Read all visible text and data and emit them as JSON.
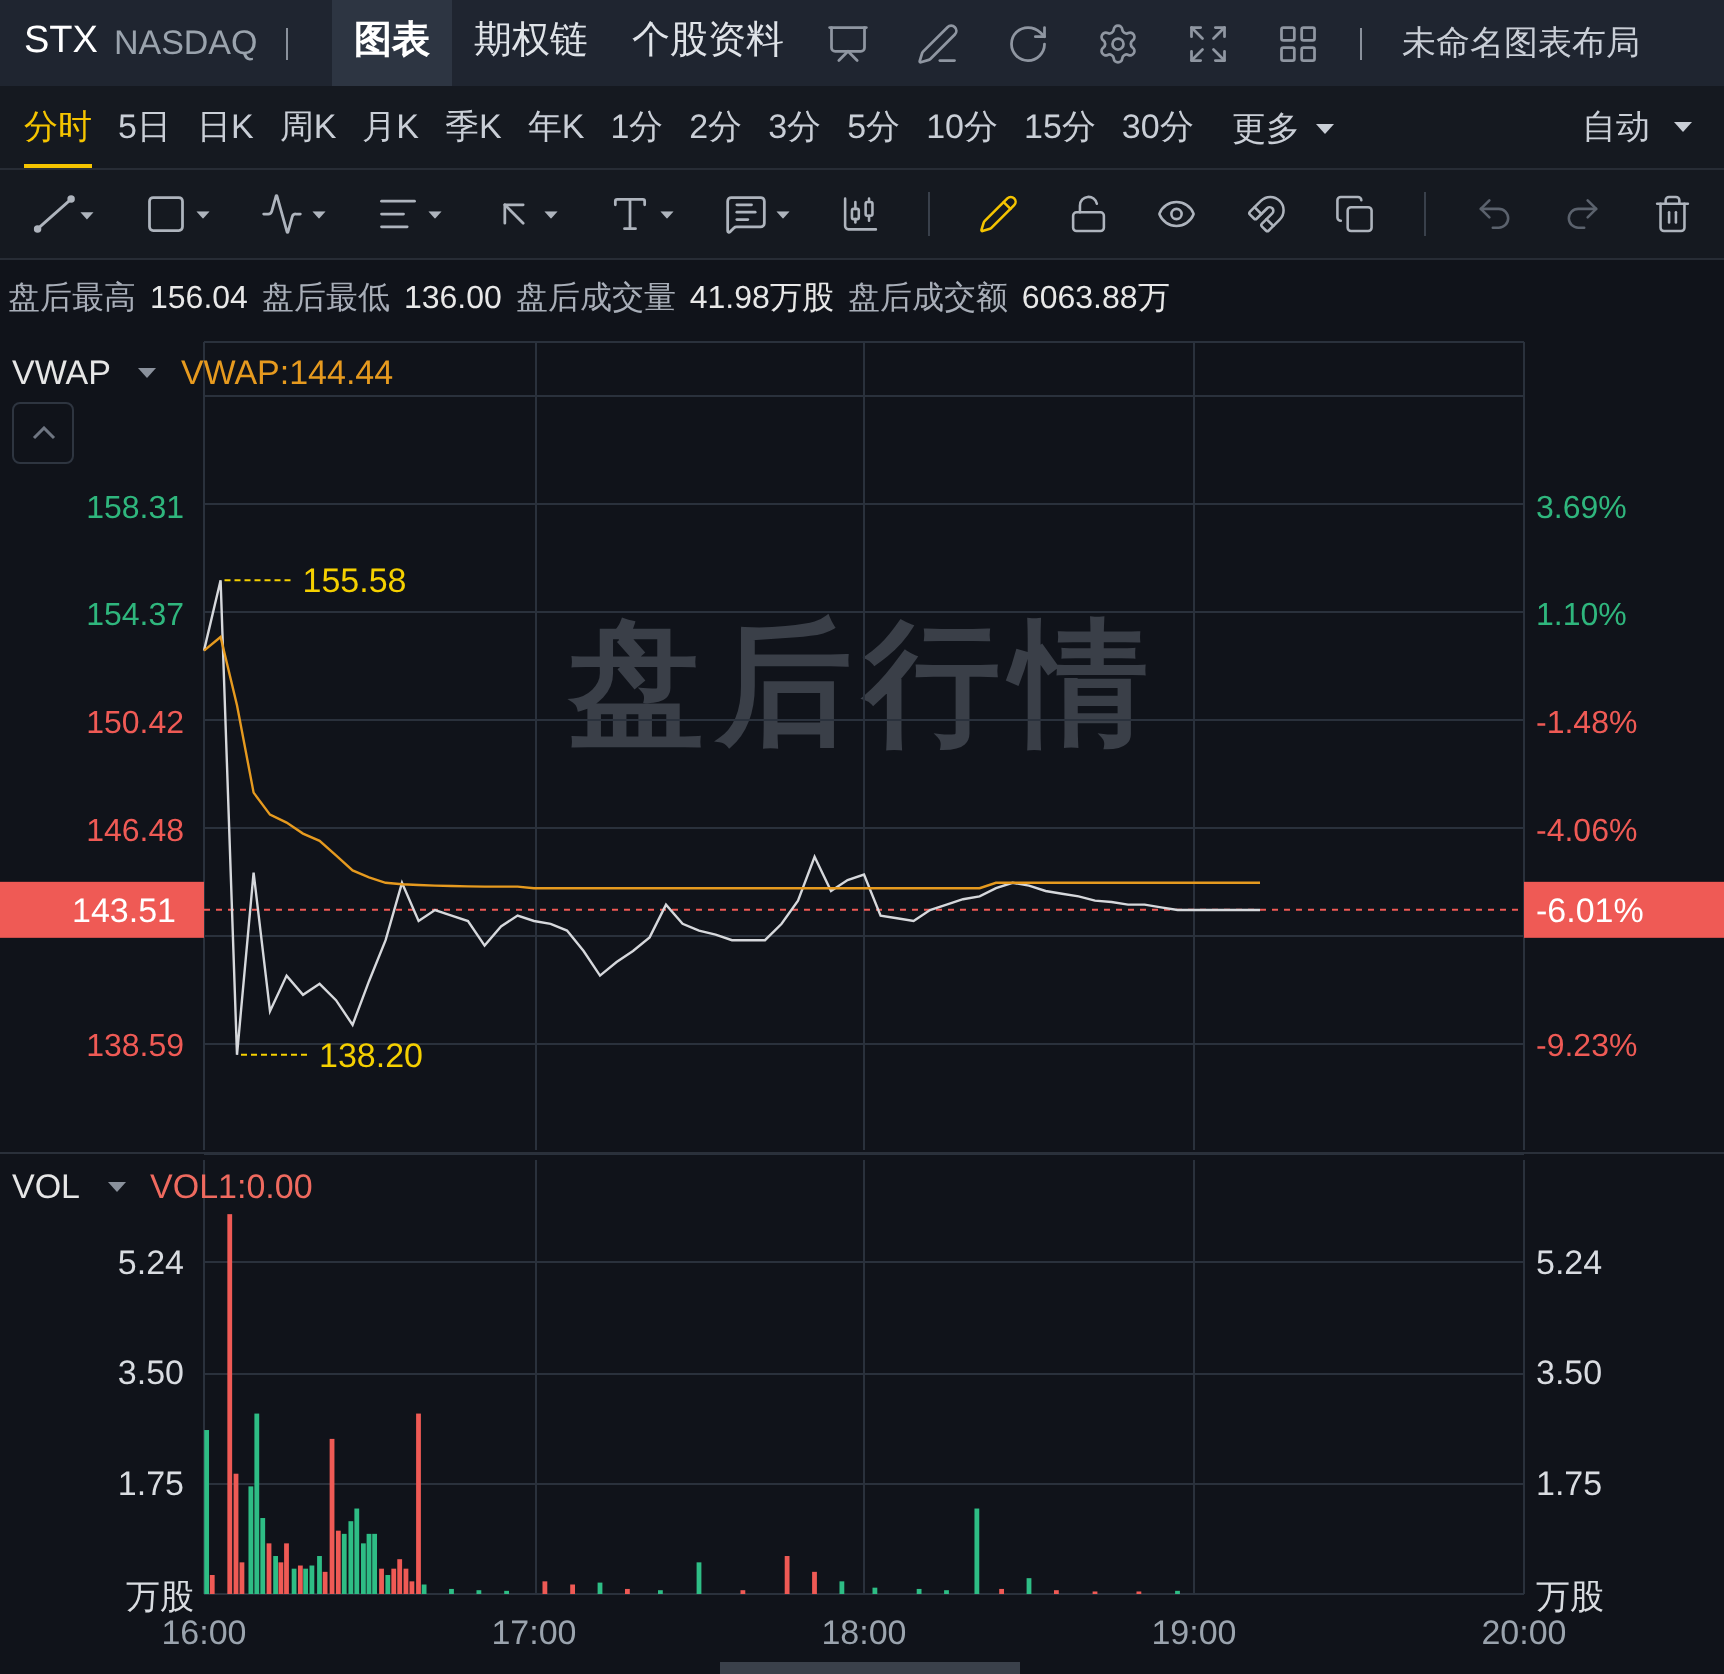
{
  "header": {
    "symbol": "STX",
    "exchange": "NASDAQ",
    "tabs": [
      {
        "label": "图表",
        "selected": true
      },
      {
        "label": "期权链",
        "selected": false
      },
      {
        "label": "个股资料",
        "selected": false
      }
    ],
    "layout_name": "未命名图表布局"
  },
  "periods": [
    {
      "label": "分时",
      "selected": true
    },
    {
      "label": "5日",
      "selected": false
    },
    {
      "label": "日K",
      "selected": false
    },
    {
      "label": "周K",
      "selected": false
    },
    {
      "label": "月K",
      "selected": false
    },
    {
      "label": "季K",
      "selected": false
    },
    {
      "label": "年K",
      "selected": false
    },
    {
      "label": "1分",
      "selected": false
    },
    {
      "label": "2分",
      "selected": false
    },
    {
      "label": "3分",
      "selected": false
    },
    {
      "label": "5分",
      "selected": false
    },
    {
      "label": "10分",
      "selected": false
    },
    {
      "label": "15分",
      "selected": false
    },
    {
      "label": "30分",
      "selected": false
    }
  ],
  "more": "更多",
  "scale": "自动",
  "toolbar": {
    "pencil_active": true,
    "undo_disabled": true,
    "redo_disabled": true
  },
  "stats": [
    {
      "label": "盘后最高",
      "value": "156.04"
    },
    {
      "label": "盘后最低",
      "value": "136.00"
    },
    {
      "label": "盘后成交量",
      "value": "41.98万股"
    },
    {
      "label": "盘后成交额",
      "value": "6063.88万"
    }
  ],
  "price_pane": {
    "reading": "VWAP:144.44",
    "watermark": "盘后行情",
    "left_axis": [
      {
        "label": "158.31",
        "color": "#2fb67d"
      },
      {
        "label": "154.37",
        "color": "#2fb67d"
      },
      {
        "label": "150.42",
        "color": "#ef5a55"
      },
      {
        "label": "146.48",
        "color": "#ef5a55"
      },
      {
        "label": "138.59",
        "color": "#ef5a55"
      }
    ],
    "right_axis": [
      {
        "label": "3.69%",
        "color": "#2fb67d"
      },
      {
        "label": "1.10%",
        "color": "#2fb67d"
      },
      {
        "label": "-1.48%",
        "color": "#ef5a55"
      },
      {
        "label": "-4.06%",
        "color": "#ef5a55"
      },
      {
        "label": "-9.23%",
        "color": "#ef5a55"
      }
    ],
    "last_change": "-6.01%",
    "chart_data": {
      "type": "line",
      "grid": true,
      "ylim": [
        134.57,
        164.3
      ],
      "categories": [
        null,
        null,
        null,
        null,
        null,
        null,
        null,
        null,
        null,
        null,
        null,
        null,
        null,
        null,
        null,
        null,
        null,
        null,
        null,
        null,
        null,
        null,
        null,
        null,
        null,
        null,
        null,
        null,
        null,
        null,
        null,
        null,
        null,
        null,
        null,
        null,
        null,
        null,
        null,
        null,
        null,
        null,
        null,
        null,
        null,
        null,
        null,
        null,
        null,
        null,
        null,
        null,
        null,
        null,
        null,
        null,
        null,
        null,
        null,
        null,
        null,
        null,
        null,
        null,
        null,
        null,
        null,
        null,
        null,
        null,
        null,
        null,
        null,
        null,
        null,
        null,
        null,
        null,
        null,
        null,
        null
      ],
      "yticks": [
        158.31,
        154.37,
        150.42,
        146.48,
        138.59
      ],
      "ref_lines": [
        {
          "axis": "y",
          "value": 143.51,
          "color": "#ef5a55",
          "label": "143.51"
        }
      ],
      "series": [
        {
          "color": "#d6d8dc",
          "values": [
            153.0,
            155.58,
            138.2,
            144.87,
            139.8,
            141.1,
            140.4,
            140.8,
            140.2,
            139.3,
            140.9,
            142.4,
            144.5,
            143.1,
            143.5,
            143.3,
            143.1,
            142.2,
            142.9,
            143.3,
            143.1,
            143.0,
            142.75,
            142.0,
            141.1,
            141.6,
            142.0,
            142.5,
            143.7,
            143.0,
            142.75,
            142.6,
            142.4,
            142.4,
            142.4,
            143.0,
            143.85,
            145.45,
            144.2,
            144.6,
            144.8,
            143.3,
            143.2,
            143.1,
            143.5,
            143.7,
            143.9,
            144.0,
            144.3,
            144.5,
            144.4,
            144.2,
            144.1,
            144.0,
            143.85,
            143.8,
            143.7,
            143.7,
            143.6,
            143.5,
            143.5,
            143.5,
            143.5,
            143.5,
            143.5,
            null,
            null,
            null,
            null,
            null,
            null,
            null,
            null,
            null,
            null,
            null,
            null,
            null,
            null,
            null,
            null
          ]
        },
        {
          "name": "VWAP",
          "color": "#e69a1f",
          "values": [
            153.0,
            153.5,
            151.0,
            147.8,
            147.0,
            146.7,
            146.3,
            146.04,
            145.5,
            144.95,
            144.7,
            144.5,
            144.45,
            144.42,
            144.4,
            144.38,
            144.37,
            144.36,
            144.36,
            144.36,
            144.3,
            144.3,
            144.3,
            144.3,
            144.3,
            144.3,
            144.3,
            144.3,
            144.3,
            144.3,
            144.3,
            144.3,
            144.3,
            144.3,
            144.3,
            144.3,
            144.3,
            144.3,
            144.3,
            144.3,
            144.3,
            144.3,
            144.3,
            144.3,
            144.3,
            144.3,
            144.3,
            144.3,
            144.5,
            144.5,
            144.5,
            144.5,
            144.5,
            144.5,
            144.5,
            144.5,
            144.5,
            144.5,
            144.5,
            144.5,
            144.5,
            144.5,
            144.5,
            144.5,
            144.5,
            null,
            null,
            null,
            null,
            null,
            null,
            null,
            null,
            null,
            null,
            null,
            null,
            null,
            null,
            null,
            null
          ]
        }
      ],
      "annotations": [
        "155.58",
        "138.20"
      ]
    }
  },
  "volume_pane": {
    "indicator": "VOL",
    "reading": "VOL1:0.00",
    "right_axis": [
      "5.24",
      "3.50",
      "1.75",
      "万股"
    ],
    "chart_data": {
      "type": "bar",
      "grid": true,
      "ylabel": "万股",
      "xlim": [
        16,
        20
      ],
      "ylim": [
        0,
        6.95
      ],
      "xticks": [
        {
          "value": 16,
          "label": "16:00"
        },
        {
          "value": 17,
          "label": "17:00"
        },
        {
          "value": 18,
          "label": "18:00"
        },
        {
          "value": 19,
          "label": "19:00"
        },
        {
          "value": 20,
          "label": "20:00"
        }
      ],
      "yticks": [
        {
          "value": 5.24,
          "label": "5.24"
        },
        {
          "value": 3.5,
          "label": "3.50"
        },
        {
          "value": 1.75,
          "label": "1.75"
        }
      ],
      "x": [
        16.008,
        16.025,
        16.078,
        16.097,
        16.115,
        16.142,
        16.16,
        16.178,
        16.197,
        16.217,
        16.233,
        16.25,
        16.273,
        16.292,
        16.308,
        16.327,
        16.35,
        16.367,
        16.388,
        16.407,
        16.425,
        16.445,
        16.463,
        16.483,
        16.5,
        16.517,
        16.538,
        16.557,
        16.575,
        16.593,
        16.612,
        16.63,
        16.65,
        16.667,
        16.75,
        16.833,
        16.917,
        17.033,
        17.117,
        17.2,
        17.283,
        17.383,
        17.5,
        17.633,
        17.767,
        17.85,
        17.933,
        18.033,
        18.167,
        18.25,
        18.342,
        18.417,
        18.5,
        18.583,
        18.7,
        18.833,
        18.95
      ],
      "series": [
        {
          "color": "#ef5a55",
          "values": [
            null,
            0.3,
            6.0,
            1.9,
            0.5,
            null,
            null,
            null,
            0.8,
            null,
            0.5,
            0.8,
            null,
            0.45,
            null,
            null,
            null,
            0.35,
            2.45,
            1.0,
            null,
            null,
            null,
            null,
            null,
            null,
            0.4,
            null,
            0.4,
            0.55,
            0.4,
            0.2,
            2.85,
            null,
            null,
            null,
            null,
            0.2,
            0.15,
            null,
            0.08,
            null,
            null,
            0.06,
            0.6,
            0.35,
            null,
            null,
            null,
            null,
            null,
            0.08,
            null,
            0.06,
            0.04,
            0.04,
            null
          ]
        },
        {
          "color": "#2ebd85",
          "values": [
            2.59,
            null,
            null,
            null,
            null,
            1.7,
            2.85,
            1.2,
            null,
            0.6,
            null,
            null,
            0.4,
            null,
            0.4,
            0.45,
            0.6,
            null,
            null,
            null,
            0.95,
            1.15,
            1.35,
            0.8,
            0.95,
            0.95,
            null,
            0.3,
            null,
            null,
            null,
            null,
            null,
            0.15,
            0.08,
            0.06,
            0.05,
            null,
            null,
            0.18,
            null,
            0.06,
            0.5,
            null,
            null,
            null,
            0.2,
            0.1,
            0.08,
            0.06,
            1.35,
            null,
            0.25,
            null,
            null,
            null,
            0.05
          ]
        }
      ]
    }
  }
}
